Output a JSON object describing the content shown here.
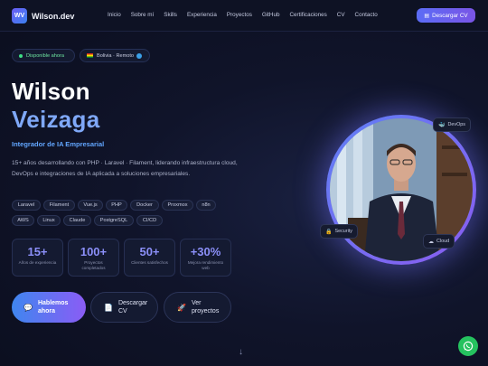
{
  "nav": {
    "logo_badge": "WV",
    "logo_text": "Wilson.dev",
    "items": [
      "Inicio",
      "Sobre mí",
      "Skills",
      "Experiencia",
      "Proyectos",
      "GitHub",
      "Certificaciones",
      "CV",
      "Contacto"
    ],
    "cv_button": "Descargar CV"
  },
  "hero": {
    "availability": "Disponible ahora",
    "location": "Bolivia · Remoto",
    "first_name": "Wilson",
    "last_name": "Veizaga",
    "role": "Integrador de IA Empresarial",
    "description": "15+ años desarrollando con PHP · Laravel · Filament, liderando infraestructura cloud, DevOps e integraciones de IA aplicada a soluciones empresariales.",
    "skills_row1": [
      "Laravel",
      "Filament",
      "Vue.js",
      "PHP",
      "Docker",
      "Proxmox",
      "n8n"
    ],
    "skills_row2": [
      "AWS",
      "Linux",
      "Claude",
      "PostgreSQL",
      "CI/CD"
    ],
    "stats": [
      {
        "value": "15+",
        "label": "Años de experiencia"
      },
      {
        "value": "100+",
        "label": "Proyectos completados"
      },
      {
        "value": "50+",
        "label": "Clientes satisfechos"
      },
      {
        "value": "+30%",
        "label": "Mejora rendimiento web"
      }
    ],
    "cta_primary": "Hablemos\nahora",
    "cta_download": "Descargar\nCV",
    "cta_projects": "Ver\nproyectos"
  },
  "portrait_tags": {
    "devops": "DevOps",
    "security": "Security",
    "cloud": "Cloud"
  },
  "colors": {
    "accent_blue": "#7fa8f8",
    "accent_purple": "#8b5cf5",
    "whatsapp": "#25c25f"
  }
}
